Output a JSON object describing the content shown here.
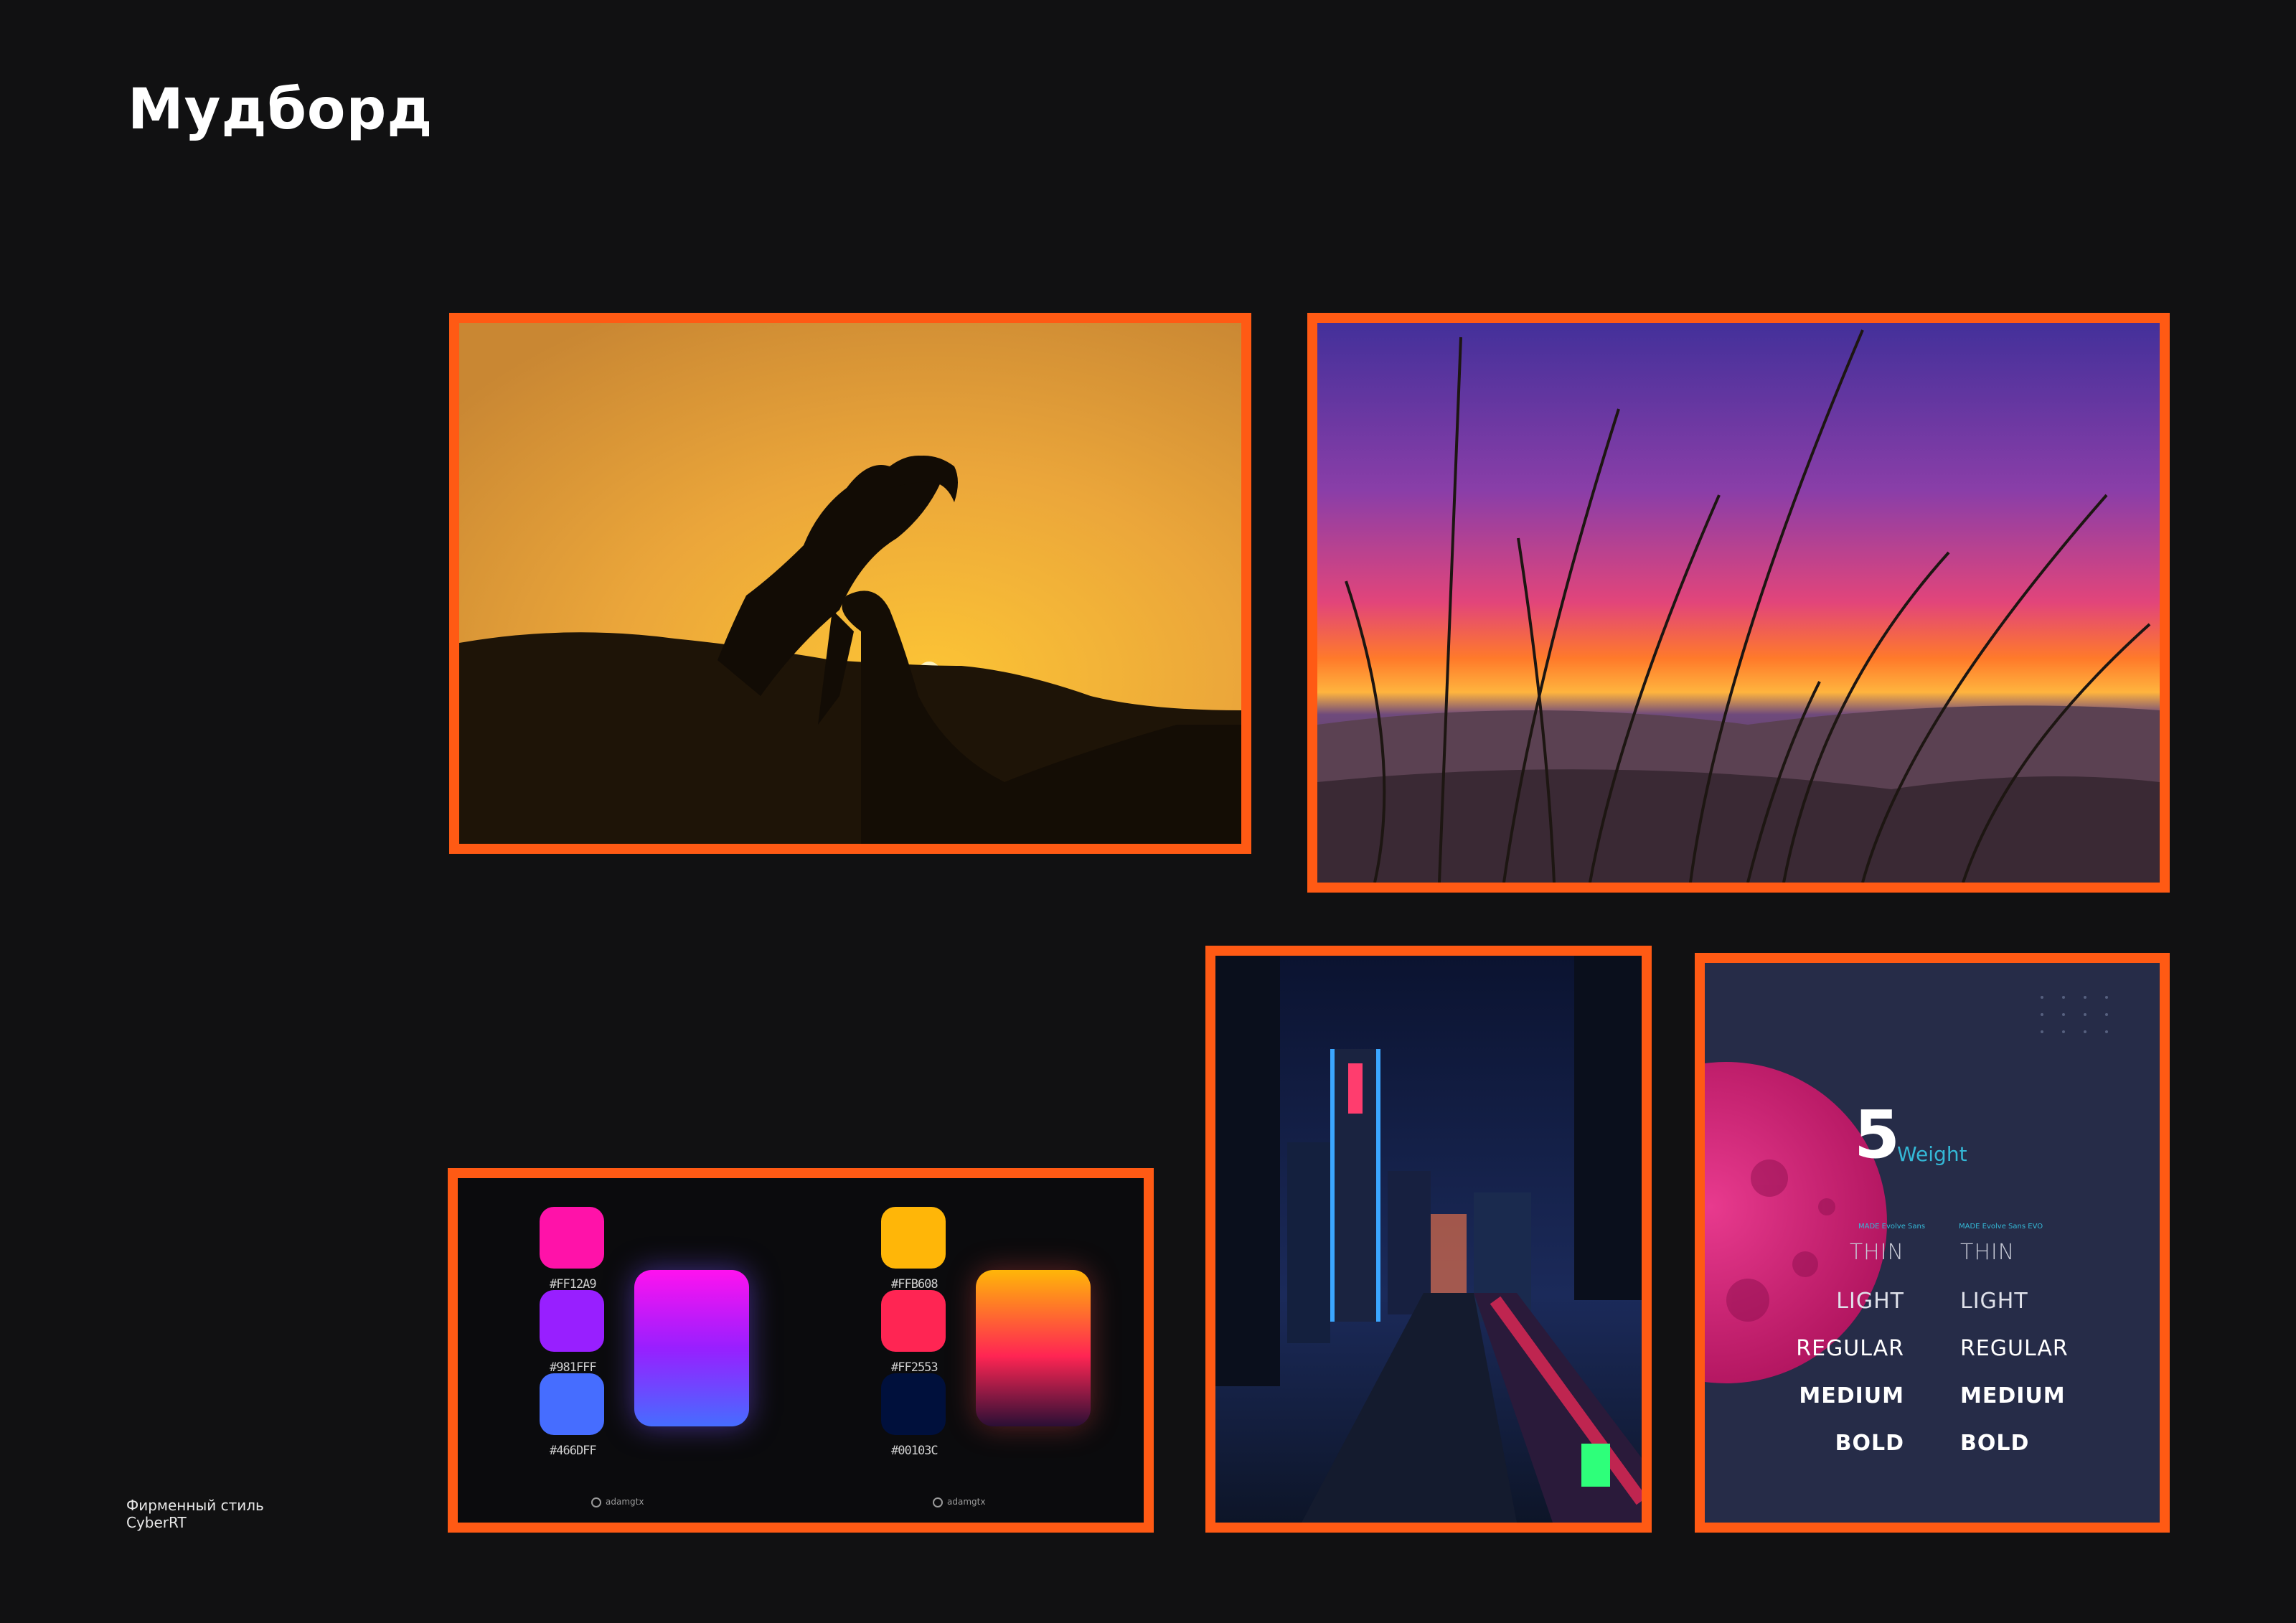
{
  "page": {
    "title": "Мудборд"
  },
  "footer": {
    "line1": "Фирменный стиль",
    "line2": "CyberRT"
  },
  "images": {
    "falcon": "falcon silhouette at sunset",
    "grass": "beach grass at sunrise",
    "city": "neon city street at night"
  },
  "palette": {
    "left": {
      "swatches": [
        {
          "hex": "#FF12A9",
          "color": "#ff12a9"
        },
        {
          "hex": "#981FFF",
          "color": "#981fff"
        },
        {
          "hex": "#466DFF",
          "color": "#466dff"
        }
      ],
      "credit": "adamgtx"
    },
    "right": {
      "swatches": [
        {
          "hex": "#FFB608",
          "color": "#ffb608"
        },
        {
          "hex": "#FF2553",
          "color": "#ff2553"
        },
        {
          "hex": "#00103C",
          "color": "#00103c"
        }
      ],
      "credit": "adamgtx"
    }
  },
  "typography": {
    "count": "5",
    "label": "Weight",
    "font1": "MADE Evolve Sans",
    "font2": "MADE Evolve Sans EVO",
    "weights": [
      "THIN",
      "LIGHT",
      "REGULAR",
      "MEDIUM",
      "BOLD"
    ]
  }
}
